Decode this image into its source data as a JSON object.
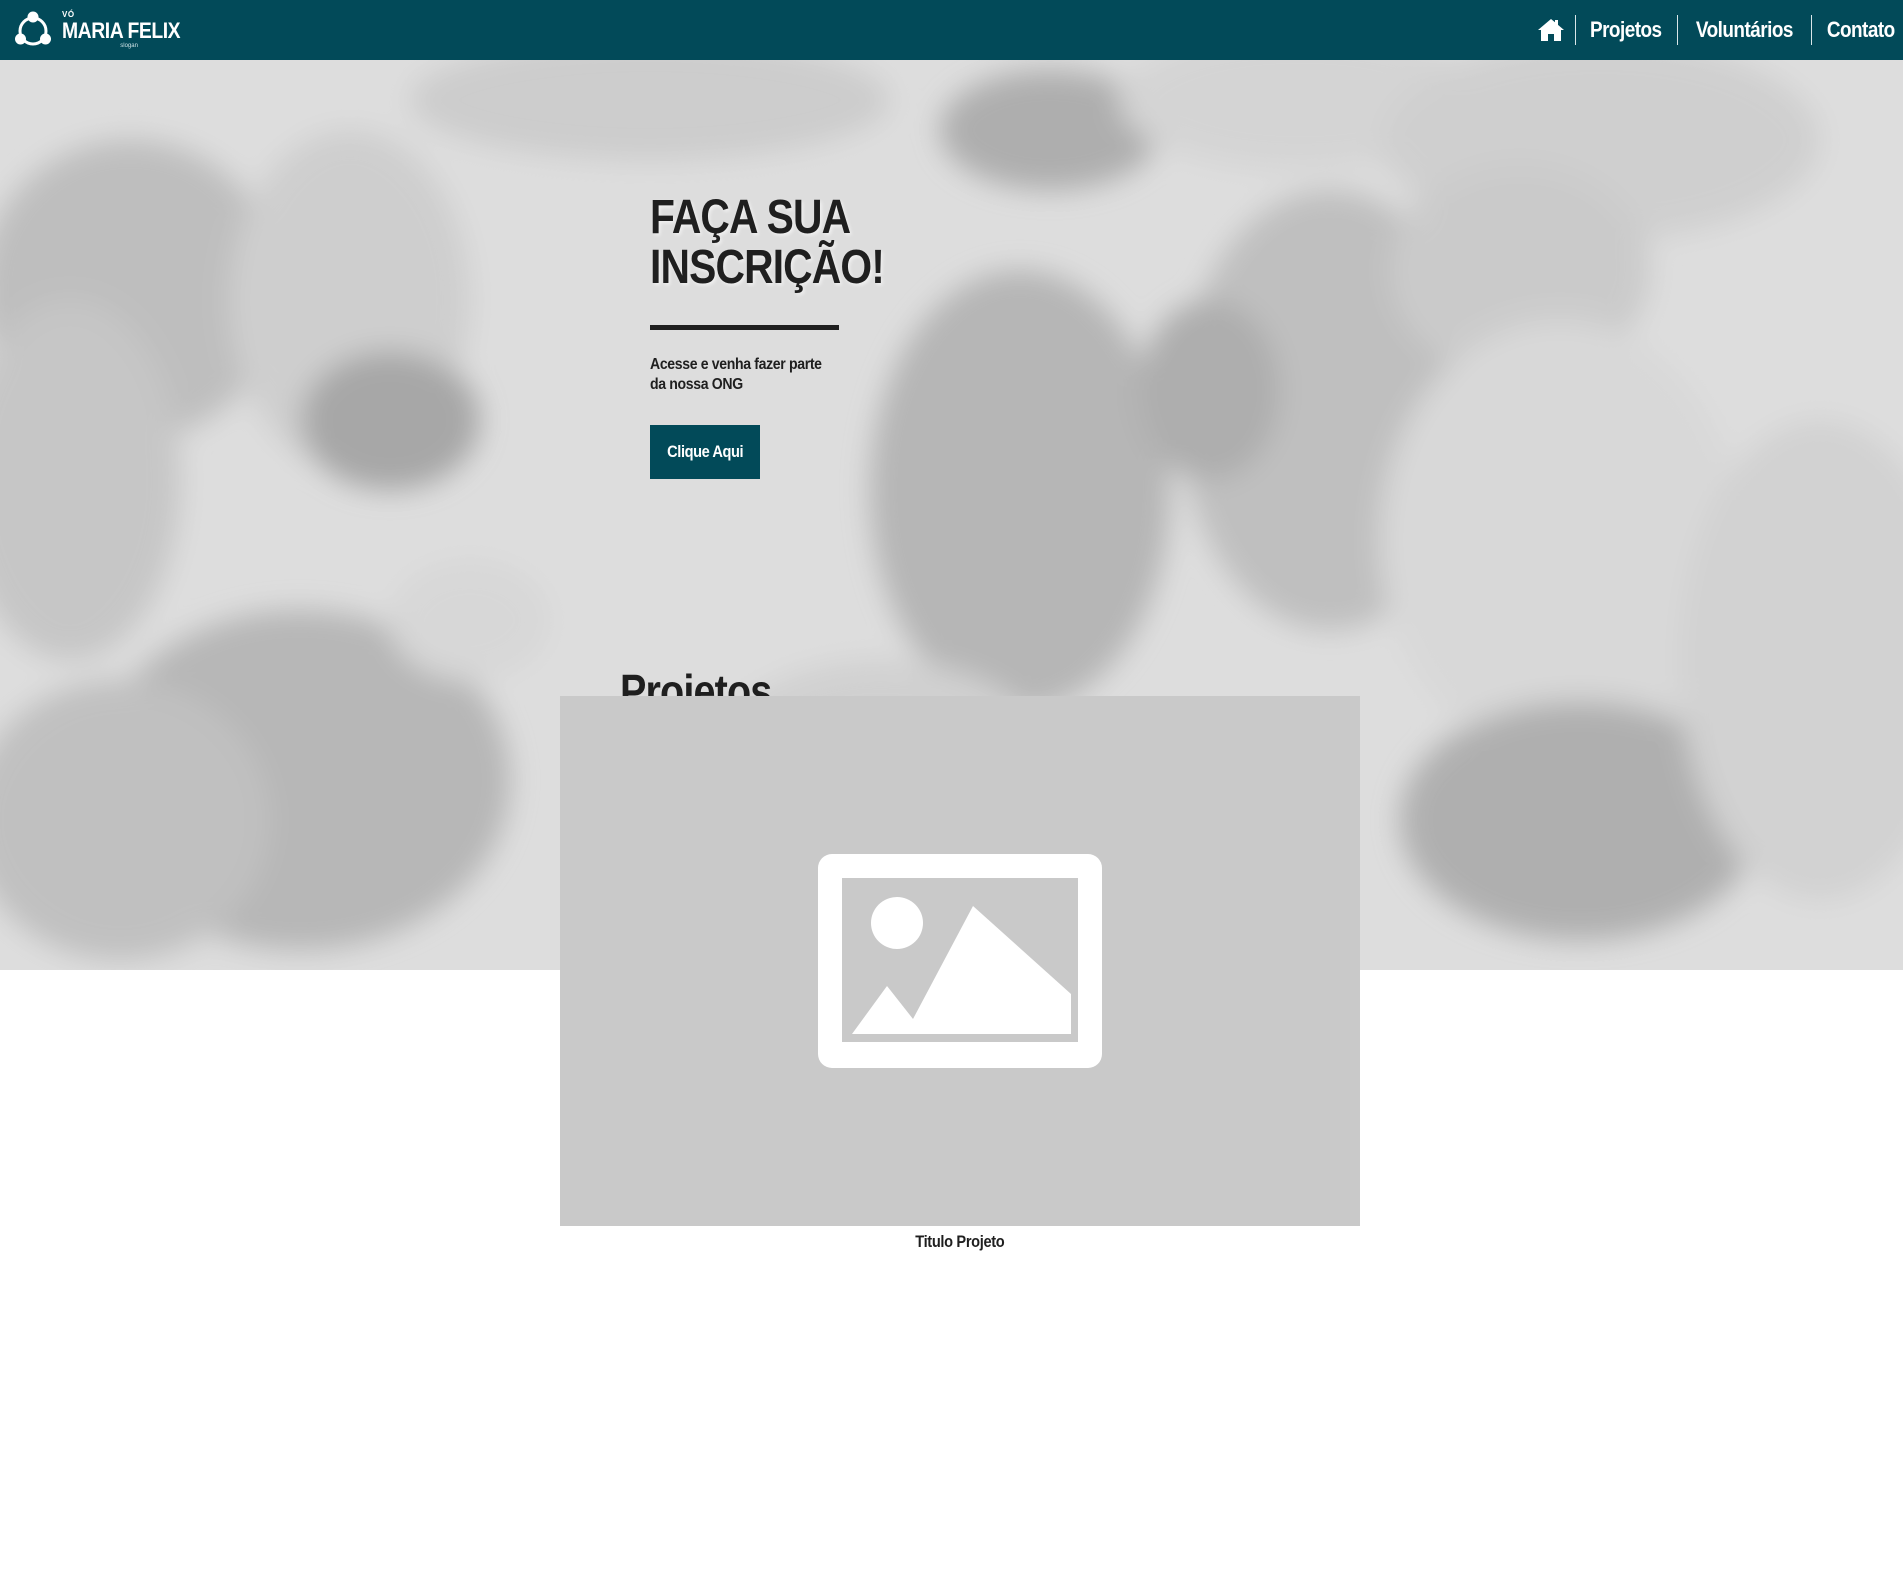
{
  "header": {
    "brand": {
      "small": "VÓ",
      "name": "MARIA FELIX",
      "slogan": "slogan"
    },
    "nav": {
      "home_icon": "home-icon",
      "items": [
        {
          "label": "Projetos"
        },
        {
          "label": "Voluntários"
        },
        {
          "label": "Contato"
        }
      ]
    }
  },
  "hero": {
    "title_line1": "FAÇA SUA",
    "title_line2": "INSCRIÇÃO!",
    "subtitle": "Acesse e venha fazer parte da nossa ONG",
    "button_label": "Clique Aqui"
  },
  "projects": {
    "section_title": "Projetos",
    "items": [
      {
        "title": "Titulo Projeto",
        "image_icon": "image-placeholder-icon"
      }
    ]
  },
  "colors": {
    "primary": "#024a59",
    "text_dark": "#1f1f1f",
    "placeholder_bg": "#c9c9c9"
  }
}
